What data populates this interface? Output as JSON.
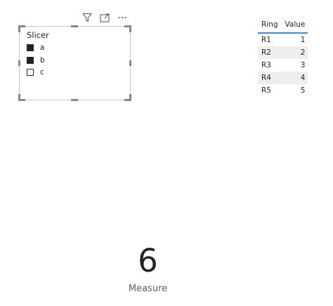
{
  "slicer": {
    "title": "Slicer",
    "items": [
      {
        "label": "a",
        "checked": true
      },
      {
        "label": "b",
        "checked": true
      },
      {
        "label": "c",
        "checked": false
      }
    ]
  },
  "visual_header": {
    "icons": [
      "filter-icon",
      "focus-mode-icon",
      "more-options-icon"
    ]
  },
  "table": {
    "headers": [
      "Ring",
      "Value"
    ],
    "rows": [
      [
        "R1",
        "1"
      ],
      [
        "R2",
        "2"
      ],
      [
        "R3",
        "3"
      ],
      [
        "R4",
        "4"
      ],
      [
        "R5",
        "5"
      ]
    ]
  },
  "card": {
    "value": "6",
    "label": "Measure"
  },
  "colors": {
    "header_underline": "#4a86c8",
    "alt_row": "#eeeeee",
    "text": "#252423"
  }
}
